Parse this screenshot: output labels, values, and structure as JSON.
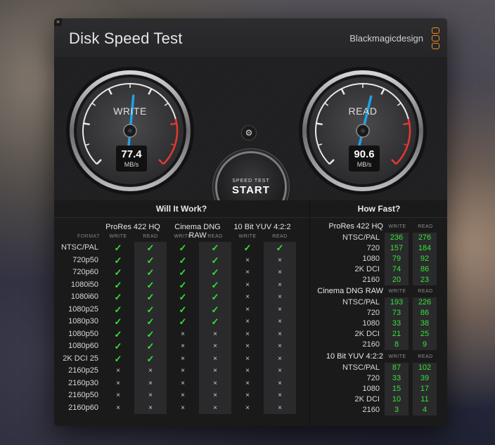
{
  "window": {
    "close_glyph": "×",
    "title": "Disk Speed Test",
    "brand": "Blackmagicdesign"
  },
  "gauges": {
    "write": {
      "label": "WRITE",
      "value": "77.4",
      "unit": "MB/s",
      "level": 0.52
    },
    "read": {
      "label": "READ",
      "value": "90.6",
      "unit": "MB/s",
      "level": 0.55
    }
  },
  "controls": {
    "settings_icon": "gear-icon",
    "start_sub": "SPEED TEST",
    "start_main": "START"
  },
  "will_it_work": {
    "title": "Will It Work?",
    "format_header": "FORMAT",
    "groups": [
      "ProRes 422 HQ",
      "Cinema DNG RAW",
      "10 Bit YUV 4:2:2"
    ],
    "col_headers": [
      "WRITE",
      "READ",
      "WRITE",
      "READ",
      "WRITE",
      "READ"
    ],
    "rows": [
      {
        "format": "NTSC/PAL",
        "cells": [
          "✓",
          "✓",
          "✓",
          "✓",
          "✓",
          "✓"
        ]
      },
      {
        "format": "720p50",
        "cells": [
          "✓",
          "✓",
          "✓",
          "✓",
          "×",
          "×"
        ]
      },
      {
        "format": "720p60",
        "cells": [
          "✓",
          "✓",
          "✓",
          "✓",
          "×",
          "×"
        ]
      },
      {
        "format": "1080i50",
        "cells": [
          "✓",
          "✓",
          "✓",
          "✓",
          "×",
          "×"
        ]
      },
      {
        "format": "1080i60",
        "cells": [
          "✓",
          "✓",
          "✓",
          "✓",
          "×",
          "×"
        ]
      },
      {
        "format": "1080p25",
        "cells": [
          "✓",
          "✓",
          "✓",
          "✓",
          "×",
          "×"
        ]
      },
      {
        "format": "1080p30",
        "cells": [
          "✓",
          "✓",
          "✓",
          "✓",
          "×",
          "×"
        ]
      },
      {
        "format": "1080p50",
        "cells": [
          "✓",
          "✓",
          "×",
          "×",
          "×",
          "×"
        ]
      },
      {
        "format": "1080p60",
        "cells": [
          "✓",
          "✓",
          "×",
          "×",
          "×",
          "×"
        ]
      },
      {
        "format": "2K DCI 25",
        "cells": [
          "✓",
          "✓",
          "×",
          "×",
          "×",
          "×"
        ]
      },
      {
        "format": "2160p25",
        "cells": [
          "×",
          "×",
          "×",
          "×",
          "×",
          "×"
        ]
      },
      {
        "format": "2160p30",
        "cells": [
          "×",
          "×",
          "×",
          "×",
          "×",
          "×"
        ]
      },
      {
        "format": "2160p50",
        "cells": [
          "×",
          "×",
          "×",
          "×",
          "×",
          "×"
        ]
      },
      {
        "format": "2160p60",
        "cells": [
          "×",
          "×",
          "×",
          "×",
          "×",
          "×"
        ]
      }
    ]
  },
  "how_fast": {
    "title": "How Fast?",
    "write_header": "WRITE",
    "read_header": "READ",
    "blocks": [
      {
        "name": "ProRes 422 HQ",
        "rows": [
          {
            "res": "NTSC/PAL",
            "write": "236",
            "read": "276"
          },
          {
            "res": "720",
            "write": "157",
            "read": "184"
          },
          {
            "res": "1080",
            "write": "79",
            "read": "92"
          },
          {
            "res": "2K DCI",
            "write": "74",
            "read": "86"
          },
          {
            "res": "2160",
            "write": "20",
            "read": "23"
          }
        ]
      },
      {
        "name": "Cinema DNG RAW",
        "rows": [
          {
            "res": "NTSC/PAL",
            "write": "193",
            "read": "226"
          },
          {
            "res": "720",
            "write": "73",
            "read": "86"
          },
          {
            "res": "1080",
            "write": "33",
            "read": "38"
          },
          {
            "res": "2K DCI",
            "write": "21",
            "read": "25"
          },
          {
            "res": "2160",
            "write": "8",
            "read": "9"
          }
        ]
      },
      {
        "name": "10 Bit YUV 4:2:2",
        "rows": [
          {
            "res": "NTSC/PAL",
            "write": "87",
            "read": "102"
          },
          {
            "res": "720",
            "write": "33",
            "read": "39"
          },
          {
            "res": "1080",
            "write": "15",
            "read": "17"
          },
          {
            "res": "2K DCI",
            "write": "10",
            "read": "11"
          },
          {
            "res": "2160",
            "write": "3",
            "read": "4"
          }
        ]
      }
    ]
  },
  "colors": {
    "accent_needle": "#1fa3e6",
    "ok": "#35e235",
    "redline": "#e33a2f",
    "brand_logo": "#f08a24"
  }
}
